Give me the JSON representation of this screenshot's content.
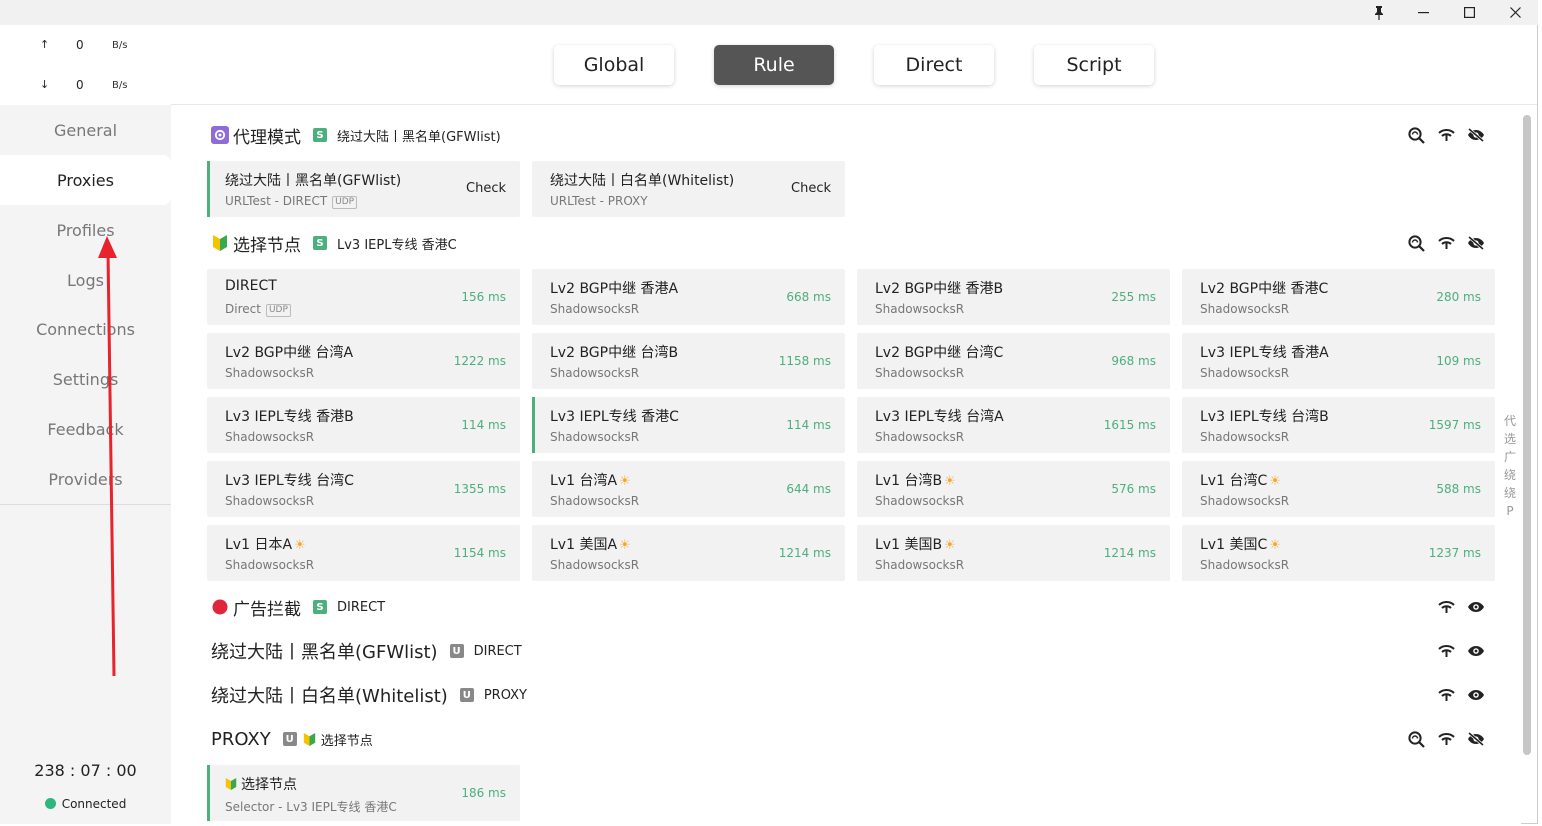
{
  "window": {
    "pin_glyph": "📌",
    "min_glyph": "—",
    "max_glyph": "☐",
    "close_glyph": "✕"
  },
  "traffic": {
    "up_arrow": "↑",
    "up_value": "0",
    "up_unit": "B/s",
    "down_arrow": "↓",
    "down_value": "0",
    "down_unit": "B/s"
  },
  "nav": [
    {
      "label": "General"
    },
    {
      "label": "Proxies",
      "active": true
    },
    {
      "label": "Profiles"
    },
    {
      "label": "Logs"
    },
    {
      "label": "Connections"
    },
    {
      "label": "Settings"
    },
    {
      "label": "Feedback"
    },
    {
      "label": "Providers"
    }
  ],
  "status": {
    "timer": "238 : 07 : 00",
    "connection": "Connected"
  },
  "modes": [
    {
      "label": "Global"
    },
    {
      "label": "Rule",
      "active": true
    },
    {
      "label": "Direct"
    },
    {
      "label": "Script"
    }
  ],
  "groups": {
    "proxy_mode": {
      "title": "代理模式",
      "badge": "S",
      "now": "绕过大陆丨黑名单(GFWlist)",
      "cards": [
        {
          "name": "绕过大陆丨黑名单(GFWlist)",
          "type": "URLTest - DIRECT",
          "udp": "UDP",
          "action": "Check",
          "selected": true
        },
        {
          "name": "绕过大陆丨白名单(Whitelist)",
          "type": "URLTest - PROXY",
          "action": "Check"
        }
      ]
    },
    "select_node": {
      "title": "选择节点",
      "badge": "S",
      "now": "Lv3 IEPL专线 香港C",
      "cards": [
        {
          "name": "DIRECT",
          "type": "Direct",
          "udp": "UDP",
          "delay": "156 ms"
        },
        {
          "name": "Lv2 BGP中继 香港A",
          "type": "ShadowsocksR",
          "delay": "668 ms"
        },
        {
          "name": "Lv2 BGP中继 香港B",
          "type": "ShadowsocksR",
          "delay": "255 ms"
        },
        {
          "name": "Lv2 BGP中继 香港C",
          "type": "ShadowsocksR",
          "delay": "280 ms"
        },
        {
          "name": "Lv2 BGP中继 台湾A",
          "type": "ShadowsocksR",
          "delay": "1222 ms"
        },
        {
          "name": "Lv2 BGP中继 台湾B",
          "type": "ShadowsocksR",
          "delay": "1158 ms"
        },
        {
          "name": "Lv2 BGP中继 台湾C",
          "type": "ShadowsocksR",
          "delay": "968 ms"
        },
        {
          "name": "Lv3 IEPL专线 香港A",
          "type": "ShadowsocksR",
          "delay": "109 ms"
        },
        {
          "name": "Lv3 IEPL专线 香港B",
          "type": "ShadowsocksR",
          "delay": "114 ms"
        },
        {
          "name": "Lv3 IEPL专线 香港C",
          "type": "ShadowsocksR",
          "delay": "114 ms",
          "selected": true
        },
        {
          "name": "Lv3 IEPL专线 台湾A",
          "type": "ShadowsocksR",
          "delay": "1615 ms"
        },
        {
          "name": "Lv3 IEPL专线 台湾B",
          "type": "ShadowsocksR",
          "delay": "1597 ms"
        },
        {
          "name": "Lv3 IEPL专线 台湾C",
          "type": "ShadowsocksR",
          "delay": "1355 ms"
        },
        {
          "name": "Lv1 台湾A",
          "type": "ShadowsocksR",
          "delay": "644 ms",
          "sun": true
        },
        {
          "name": "Lv1 台湾B",
          "type": "ShadowsocksR",
          "delay": "576 ms",
          "sun": true
        },
        {
          "name": "Lv1 台湾C",
          "type": "ShadowsocksR",
          "delay": "588 ms",
          "sun": true
        },
        {
          "name": "Lv1 日本A",
          "type": "ShadowsocksR",
          "delay": "1154 ms",
          "sun": true
        },
        {
          "name": "Lv1 美国A",
          "type": "ShadowsocksR",
          "delay": "1214 ms",
          "sun": true
        },
        {
          "name": "Lv1 美国B",
          "type": "ShadowsocksR",
          "delay": "1214 ms",
          "sun": true
        },
        {
          "name": "Lv1 美国C",
          "type": "ShadowsocksR",
          "delay": "1237 ms",
          "sun": true
        }
      ]
    },
    "ad_block": {
      "title": "广告拦截",
      "badge": "S",
      "now": "DIRECT"
    },
    "gfwlist": {
      "title": "绕过大陆丨黑名单(GFWlist)",
      "badge": "U",
      "now": "DIRECT"
    },
    "whitelist": {
      "title": "绕过大陆丨白名单(Whitelist)",
      "badge": "U",
      "now": "PROXY"
    },
    "proxy": {
      "title": "PROXY",
      "badge": "U",
      "now": "选择节点",
      "cards": [
        {
          "name": "选择节点",
          "type": "Selector - Lv3 IEPL专线 香港C",
          "delay": "186 ms",
          "selected": true
        }
      ]
    }
  },
  "side_strip": [
    "代",
    "选",
    "广",
    "绕",
    "绕",
    "P"
  ],
  "colors": {
    "accent_green": "#4caf7d",
    "active_mode_bg": "#555555",
    "annotation_red": "#e8232b"
  }
}
